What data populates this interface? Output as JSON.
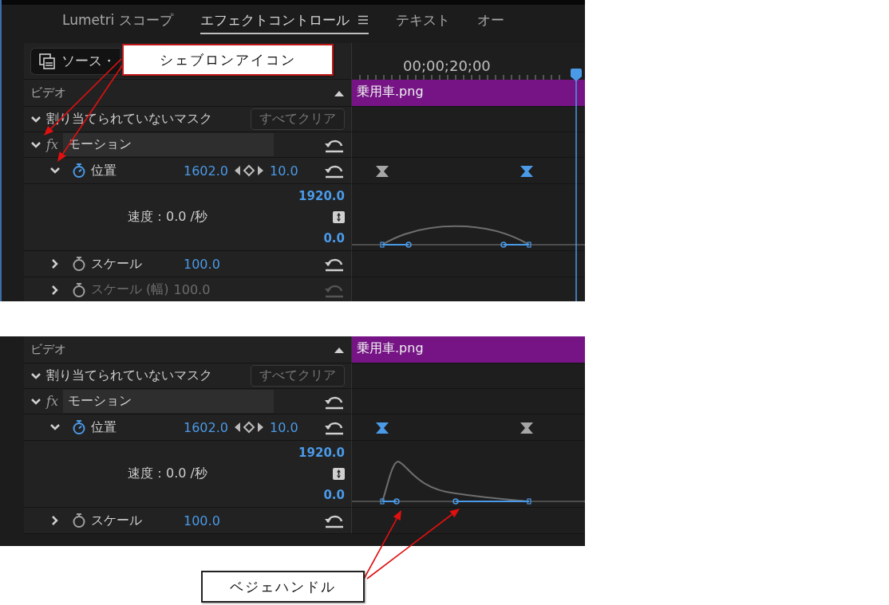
{
  "shots": [
    {
      "tabs": [
        {
          "label": "Lumetri スコープ",
          "selected": false
        },
        {
          "label": "エフェクトコントロール",
          "selected": true
        },
        {
          "label": "テキスト",
          "selected": false
        },
        {
          "label": "オー",
          "selected": false
        }
      ],
      "source": {
        "label": "ソース・"
      },
      "ruler": {
        "timecode": "00;00;20;00"
      },
      "rows": [
        {
          "kind": "section",
          "label": "ビデオ",
          "expanded": true,
          "clip": "乗用車.png"
        },
        {
          "kind": "mask",
          "label": "割り当てられていないマスク",
          "expanded": true,
          "button": "すべてクリア"
        },
        {
          "kind": "effect",
          "badge": "fx",
          "label": "モーション",
          "expanded": true
        },
        {
          "kind": "property",
          "label": "位置",
          "expanded": true,
          "animated": true,
          "disabled": false,
          "value": "1602.0",
          "value_2": "10.0",
          "keyframes": [
            {
              "selected": false
            },
            {
              "selected": true
            }
          ]
        },
        {
          "kind": "graph",
          "max": "1920.0",
          "speed": "速度：0.0 /秒",
          "min": "0.0"
        },
        {
          "kind": "property",
          "label": "スケール",
          "expanded": false,
          "animated": false,
          "disabled": false,
          "value": "100.0"
        },
        {
          "kind": "property",
          "label": "スケール (幅)",
          "expanded": false,
          "animated": false,
          "disabled": true,
          "value": "100.0"
        }
      ]
    },
    {
      "rows": [
        {
          "kind": "section",
          "label": "ビデオ",
          "expanded": true,
          "clip": "乗用車.png"
        },
        {
          "kind": "mask",
          "label": "割り当てられていないマスク",
          "expanded": true,
          "button": "すべてクリア"
        },
        {
          "kind": "effect",
          "badge": "fx",
          "label": "モーション",
          "expanded": true
        },
        {
          "kind": "property",
          "label": "位置",
          "expanded": true,
          "animated": true,
          "disabled": false,
          "value": "1602.0",
          "value_2": "10.0",
          "keyframes": [
            {
              "selected": true
            },
            {
              "selected": false
            }
          ]
        },
        {
          "kind": "graph",
          "max": "1920.0",
          "speed": "速度：0.0 /秒",
          "min": "0.0"
        },
        {
          "kind": "property",
          "label": "スケール",
          "expanded": false,
          "animated": false,
          "disabled": false,
          "value": "100.0"
        }
      ]
    }
  ],
  "callouts": [
    {
      "text": "シェブロンアイコン"
    },
    {
      "text": "ベジェハンドル"
    }
  ]
}
